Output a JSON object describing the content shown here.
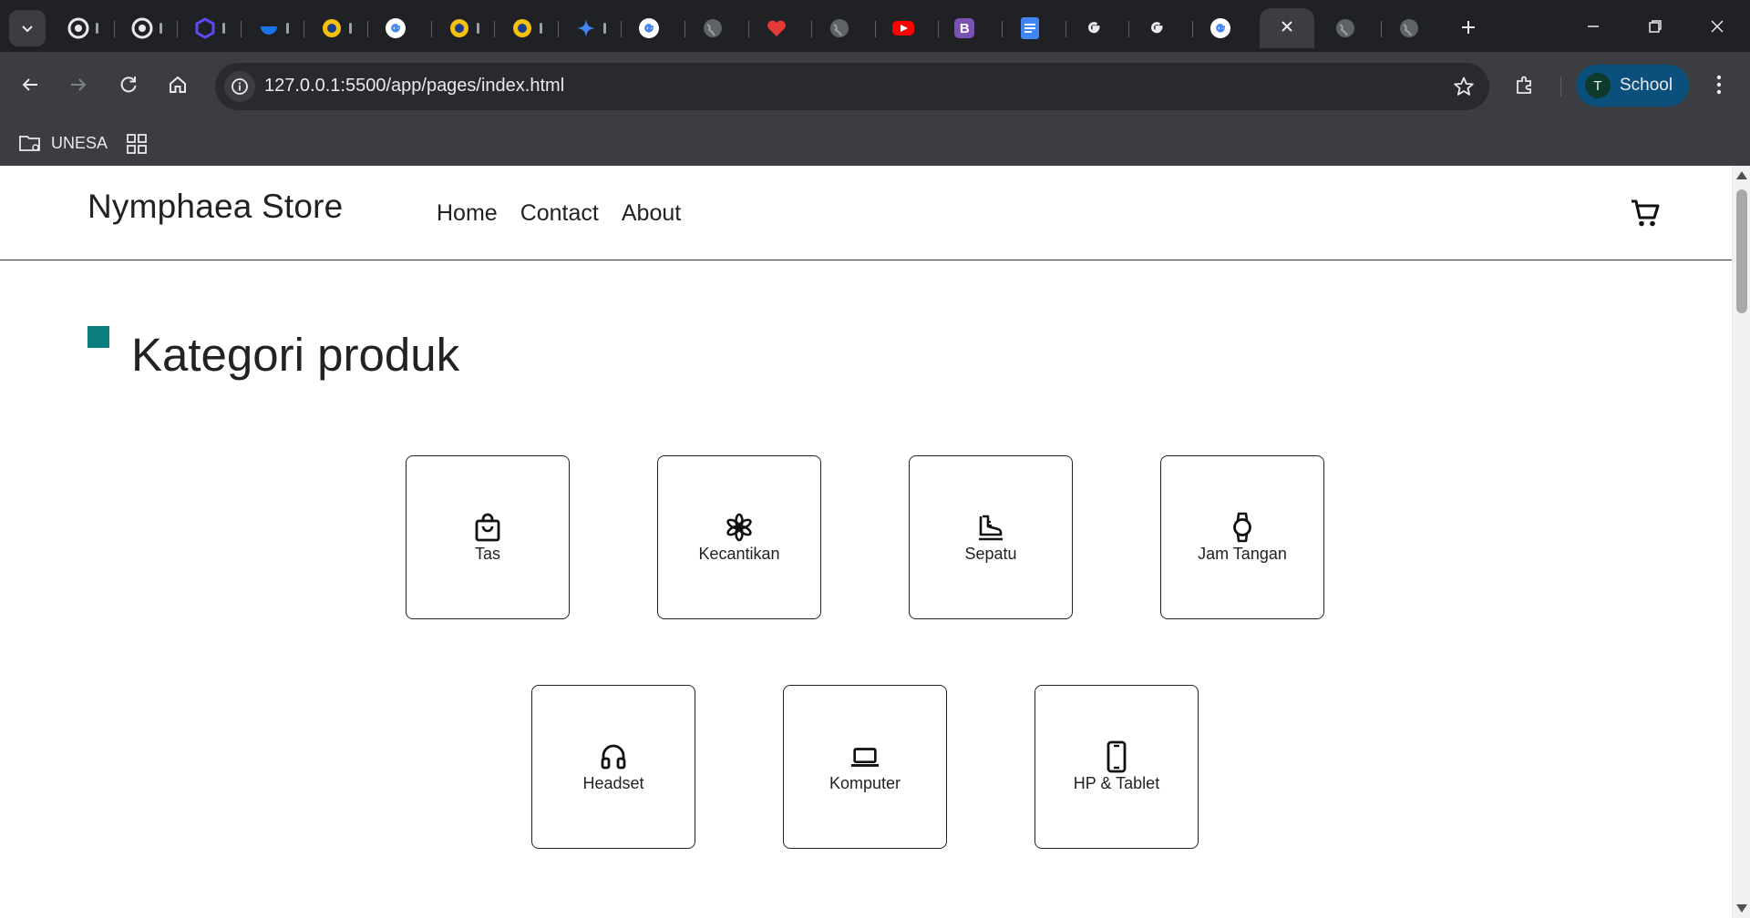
{
  "browser": {
    "url": "127.0.0.1:5500/app/pages/index.html",
    "profile": {
      "initial": "T",
      "name": "School"
    },
    "bookmarks": [
      {
        "label": "UNESA"
      }
    ],
    "tabs": [
      {
        "favicon": "chrome-icon",
        "color": "#e8eaed"
      },
      {
        "favicon": "chrome-icon",
        "color": "#e8eaed"
      },
      {
        "favicon": "hexagon-icon",
        "color": "#5b4bff"
      },
      {
        "favicon": "bowl-icon",
        "color": "#1a73e8"
      },
      {
        "favicon": "university-seal-icon",
        "color": "#f4c20d"
      },
      {
        "favicon": "google-icon",
        "color": "#ffffff"
      },
      {
        "favicon": "university-seal-icon",
        "color": "#f4c20d"
      },
      {
        "favicon": "university-seal-icon",
        "color": "#f4c20d"
      },
      {
        "favicon": "gemini-sparkle-icon",
        "color": "#4285f4"
      },
      {
        "favicon": "google-icon",
        "color": "#ffffff"
      },
      {
        "favicon": "globe-icon",
        "color": "#9aa0a6"
      },
      {
        "favicon": "heart-icon",
        "color": "#e53935"
      },
      {
        "favicon": "globe-icon",
        "color": "#9aa0a6"
      },
      {
        "favicon": "youtube-icon",
        "color": "#ff0000"
      },
      {
        "favicon": "bootstrap-icon",
        "color": "#7952b3"
      },
      {
        "favicon": "docs-icon",
        "color": "#4285f4"
      },
      {
        "favicon": "google-g-icon",
        "color": "#e8eaed"
      },
      {
        "favicon": "google-g-icon",
        "color": "#e8eaed"
      },
      {
        "favicon": "google-icon",
        "color": "#ffffff"
      },
      {
        "favicon": "close-icon",
        "color": "#e8eaed",
        "active": true
      },
      {
        "favicon": "globe-icon",
        "color": "#9aa0a6"
      },
      {
        "favicon": "globe-icon",
        "color": "#9aa0a6"
      }
    ]
  },
  "site": {
    "brand": "Nymphaea Store",
    "nav": [
      "Home",
      "Contact",
      "About"
    ],
    "section_title": "Kategori produk",
    "accent_color": "#0b7f7f",
    "categories": [
      {
        "label": "Tas",
        "icon": "shopping-bag-icon"
      },
      {
        "label": "Kecantikan",
        "icon": "flower-icon"
      },
      {
        "label": "Sepatu",
        "icon": "shoe-icon"
      },
      {
        "label": "Jam Tangan",
        "icon": "watch-icon"
      },
      {
        "label": "Headset",
        "icon": "headset-icon"
      },
      {
        "label": "Komputer",
        "icon": "laptop-icon"
      },
      {
        "label": "HP & Tablet",
        "icon": "phone-icon"
      }
    ]
  }
}
